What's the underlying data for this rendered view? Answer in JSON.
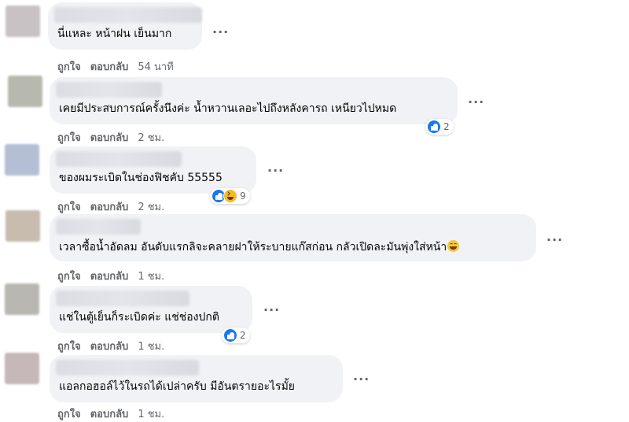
{
  "comments": [
    {
      "text": "นี่แหละ หน้าฝน เย็นมาก",
      "like_label": "ถูกใจ",
      "reply_label": "ตอบกลับ",
      "time": "54 นาที",
      "avatar_color": "#c9c2c4",
      "more_label": "···"
    },
    {
      "text": "เคยมีประสบการณ์ครั้งนึงค่ะ น้ำหวานเลอะไปถึงหลังคารถ เหนียวไปหมด",
      "like_label": "ถูกใจ",
      "reply_label": "ตอบกลับ",
      "time": "2 ชม.",
      "avatar_color": "#b8b9ae",
      "more_label": "···",
      "reactions": {
        "icons": [
          "like-icon"
        ],
        "count": "2"
      }
    },
    {
      "text": "ของผมระเบิดในช่องฟิชคับ 55555",
      "like_label": "ถูกใจ",
      "reply_label": "ตอบกลับ",
      "time": "2 ชม.",
      "avatar_color": "#b4bfd6",
      "more_label": "···",
      "reactions": {
        "icons": [
          "like-icon",
          "haha-icon"
        ],
        "count": "9"
      }
    },
    {
      "text": "เวลาซื้อน้ำอัดลม อันดับแรกลิจะคลายฝาให้ระบายแก๊สก่อน กลัวเปิดละมันพุ่งใส่หน้า",
      "like_label": "ถูกใจ",
      "reply_label": "ตอบกลับ",
      "time": "1 ชม.",
      "avatar_color": "#c7bcae",
      "more_label": "···",
      "emoji": "grinning-sweat-emoji"
    },
    {
      "text": "แช่ในตู้เย็นก็ระเบิดค่ะ แช่ช่องปกติ",
      "like_label": "ถูกใจ",
      "reply_label": "ตอบกลับ",
      "time": "1 ชม.",
      "avatar_color": "#b9b7b1",
      "more_label": "···",
      "reactions": {
        "icons": [
          "like-icon"
        ],
        "count": "2"
      }
    },
    {
      "text": "แอลกอฮอล์ไว้ในรถได้เปล่าครับ มีอันตรายอะไรมั้ย",
      "like_label": "ถูกใจ",
      "reply_label": "ตอบกลับ",
      "time": "1 ชม.",
      "avatar_color": "#c6b7b8",
      "more_label": "···"
    }
  ],
  "colors": {
    "bubble": "#f0f2f5",
    "secondary_text": "#65676b",
    "like_blue": "#1877f2"
  }
}
